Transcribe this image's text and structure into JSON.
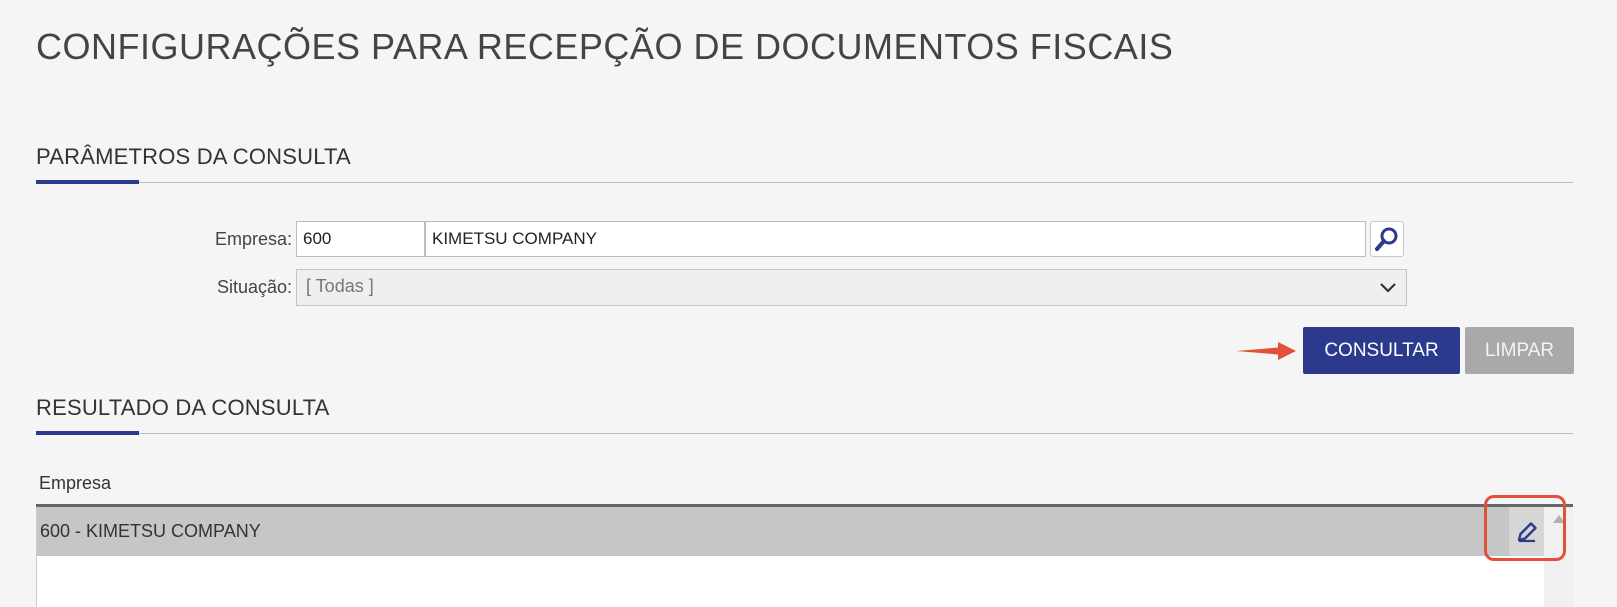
{
  "page": {
    "title": "CONFIGURAÇÕES PARA RECEPÇÃO DE DOCUMENTOS FISCAIS"
  },
  "params_section": {
    "title": "PARÂMETROS DA CONSULTA",
    "empresa": {
      "label": "Empresa:",
      "code_value": "600",
      "name_value": "KIMETSU COMPANY",
      "search_icon": "magnifier-icon"
    },
    "situacao": {
      "label": "Situação:",
      "selected": "[ Todas ]",
      "chevron_icon": "chevron-down-icon"
    },
    "buttons": {
      "consultar": "CONSULTAR",
      "limpar": "LIMPAR"
    }
  },
  "results_section": {
    "title": "RESULTADO DA CONSULTA",
    "columns": [
      "Empresa"
    ],
    "rows": [
      {
        "empresa": "600 - KIMETSU COMPANY",
        "action_icon": "pencil-icon"
      }
    ]
  },
  "colors": {
    "accent": "#2b3a8c",
    "annotation": "#e0513a",
    "selected_row": "#c6c6c6"
  }
}
